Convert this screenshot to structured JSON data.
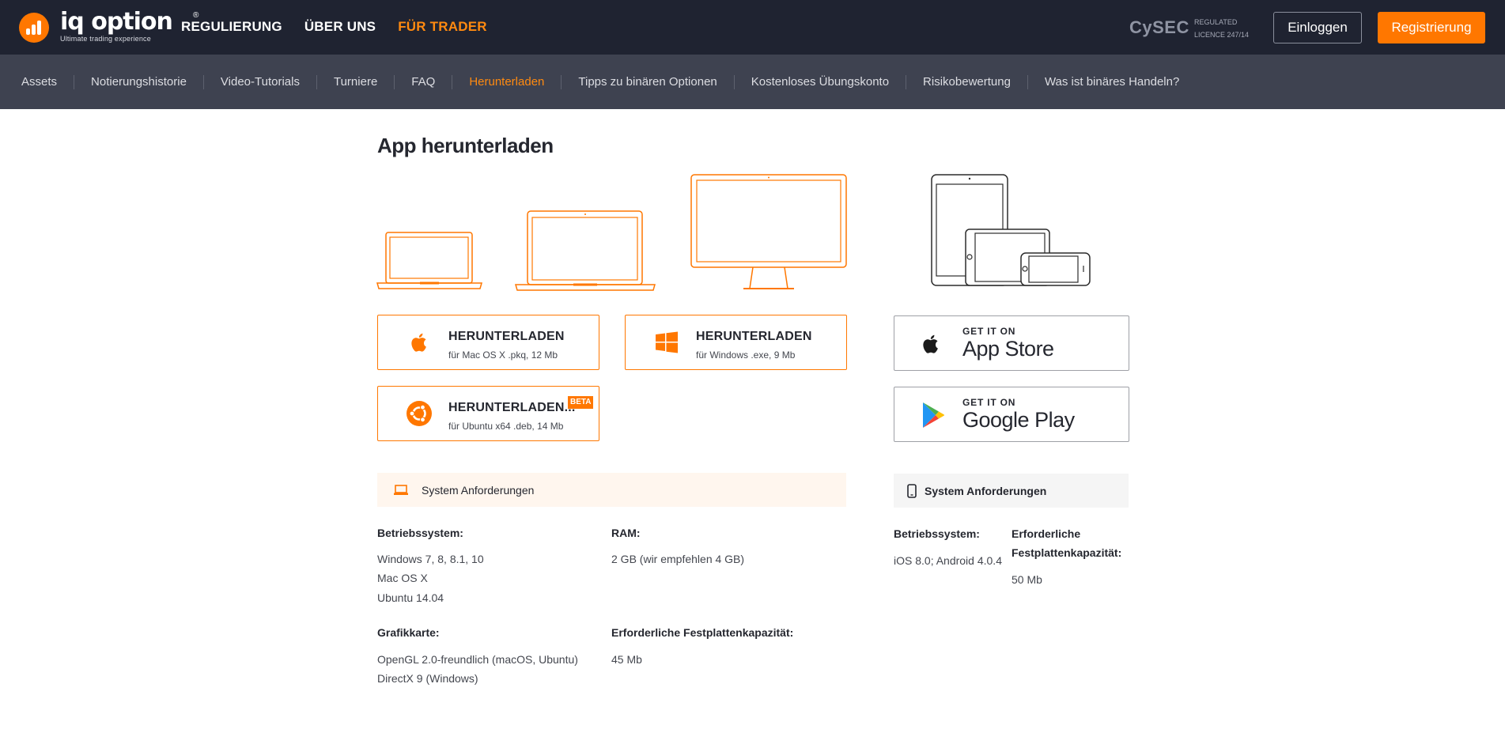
{
  "header": {
    "logo_text": "iq option",
    "logo_reg": "®",
    "logo_tagline": "Ultimate trading experience",
    "nav": [
      "REGULIERUNG",
      "ÜBER UNS",
      "FÜR TRADER"
    ],
    "nav_active_index": 2,
    "cysec": "CySEC",
    "regulated_line1": "REGULATED",
    "regulated_line2": "LICENCE 247/14",
    "login_label": "Einloggen",
    "register_label": "Registrierung"
  },
  "subnav": {
    "items": [
      "Assets",
      "Notierungshistorie",
      "Video-Tutorials",
      "Turniere",
      "FAQ",
      "Herunterladen",
      "Tipps zu binären Optionen",
      "Kostenloses Übungskonto",
      "Risikobewertung",
      "Was ist binäres Handeln?"
    ],
    "active_index": 5
  },
  "page": {
    "title": "App herunterladen"
  },
  "downloads": {
    "mac": {
      "title": "HERUNTERLADEN",
      "sub": "für Mac OS X .pkq, 12 Mb",
      "icon": "apple-icon"
    },
    "windows": {
      "title": "HERUNTERLADEN",
      "sub": "für Windows .exe, 9 Mb",
      "icon": "windows-icon"
    },
    "ubuntu": {
      "title": "HERUNTERLADEN...",
      "sub": "für Ubuntu x64 .deb, 14 Mb",
      "badge": "BETA",
      "icon": "ubuntu-icon"
    }
  },
  "stores": {
    "appstore": {
      "small": "GET IT ON",
      "big": "App Store",
      "icon": "apple-icon"
    },
    "googleplay": {
      "small": "GET IT ON",
      "big": "Google Play",
      "icon": "google-play-icon"
    }
  },
  "desktop_requirements": {
    "heading": "System Anforderungen",
    "os_label": "Betriebssystem:",
    "os_values": [
      "Windows 7, 8, 8.1, 10",
      "Mac OS X",
      "Ubuntu 14.04"
    ],
    "ram_label": "RAM:",
    "ram_value": "2 GB (wir empfehlen 4 GB)",
    "gpu_label": "Grafikkarte:",
    "gpu_values": [
      "OpenGL 2.0-freundlich (macOS, Ubuntu)",
      "DirectX 9 (Windows)"
    ],
    "disk_label": "Erforderliche Festplattenkapazität:",
    "disk_value": "45 Mb"
  },
  "mobile_requirements": {
    "heading": "System Anforderungen",
    "os_label": "Betriebssystem:",
    "os_value": "iOS 8.0; Android 4.0.4",
    "disk_label_1": "Erforderliche",
    "disk_label_2": "Festplattenkapazität:",
    "disk_value": "50 Mb"
  },
  "colors": {
    "accent": "#ff7700",
    "header_bg": "#1f2331",
    "subnav_bg": "#3e4250"
  }
}
